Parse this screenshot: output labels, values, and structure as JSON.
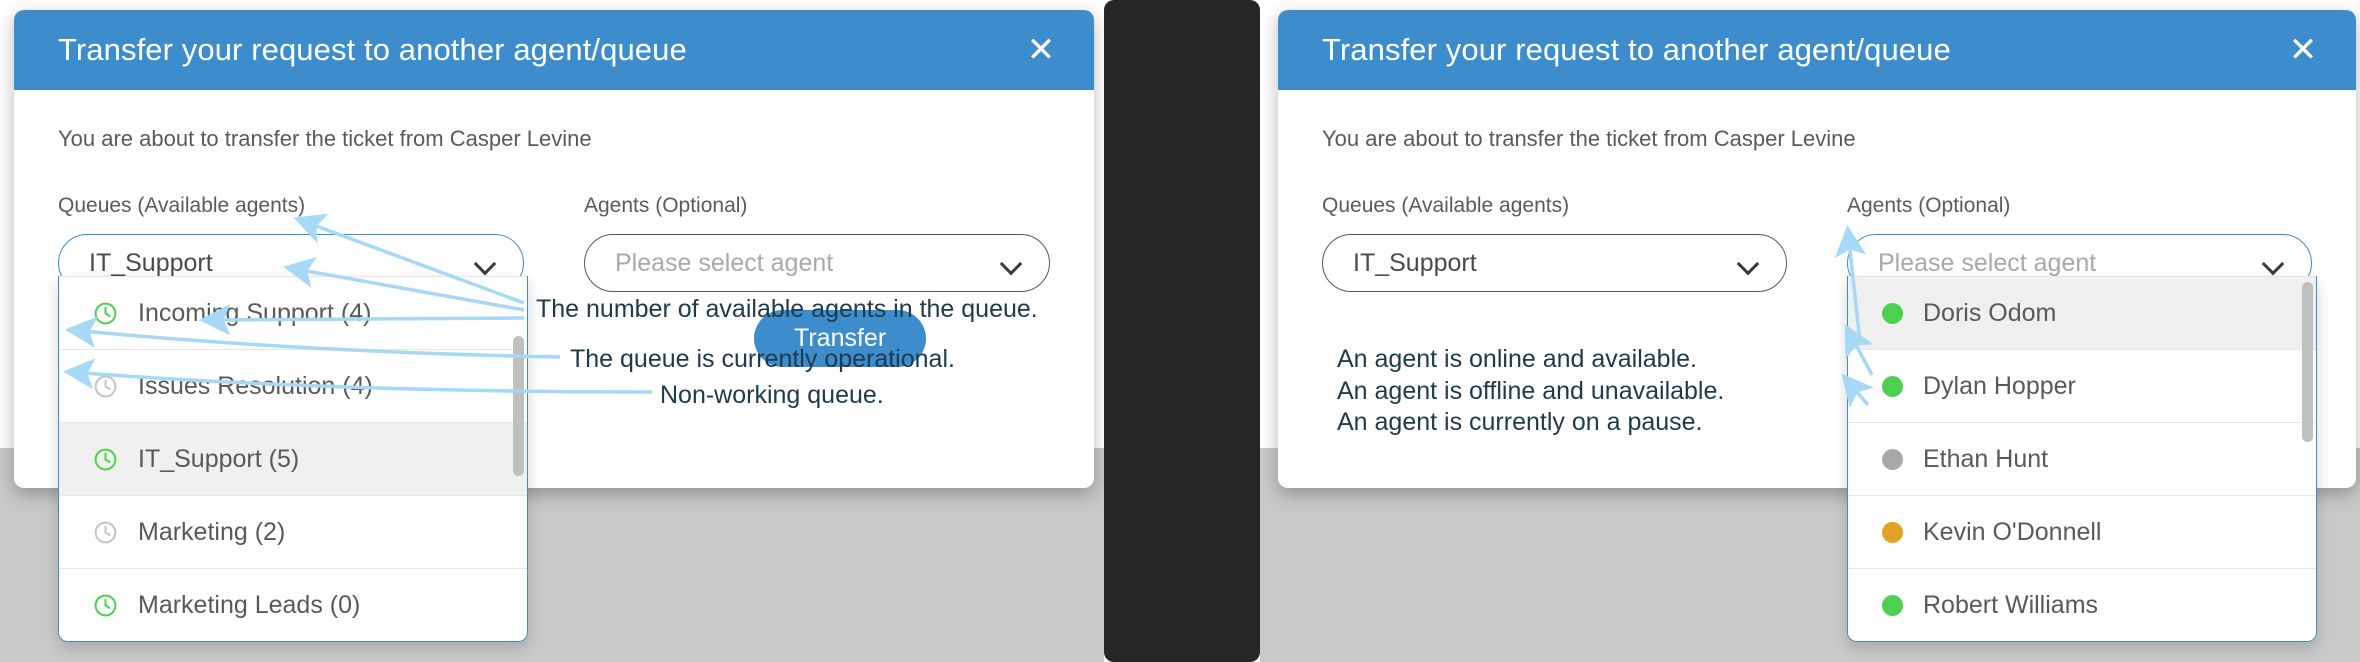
{
  "dialog": {
    "title": "Transfer your request to another agent/queue",
    "close_icon": "close-icon",
    "subtitle": "You are about to transfer the ticket from Casper Levine",
    "queues_label": "Queues (Available agents)",
    "agents_label": "Agents (Optional)",
    "queue_value": "IT_Support",
    "agent_placeholder": "Please select agent",
    "transfer_label": "Transfer"
  },
  "colors": {
    "header_blue": "#3d8dcc",
    "online_green": "#4ed04e",
    "offline_gray": "#a8a8a8",
    "pause_orange": "#e0a324",
    "annotation_text": "#1e3a4d",
    "arrow_blue": "#a7d8f5",
    "selected_row": "#f0f0f0",
    "gap_dark": "#262626"
  },
  "queues": [
    {
      "label": "Incoming Support (4)",
      "status": "operational",
      "icon": "clock-icon",
      "selected": false
    },
    {
      "label": "Issues Resolution (4)",
      "status": "non-working",
      "icon": "clock-icon",
      "selected": false
    },
    {
      "label": "IT_Support (5)",
      "status": "operational",
      "icon": "clock-icon",
      "selected": true
    },
    {
      "label": "Marketing (2)",
      "status": "non-working",
      "icon": "clock-icon",
      "selected": false
    },
    {
      "label": "Marketing Leads (0)",
      "status": "operational",
      "icon": "clock-icon",
      "selected": false
    }
  ],
  "agents": [
    {
      "label": "Doris Odom",
      "status": "online",
      "icon": "status-dot-icon",
      "selected": true
    },
    {
      "label": "Dylan Hopper",
      "status": "online",
      "icon": "status-dot-icon",
      "selected": false
    },
    {
      "label": "Ethan Hunt",
      "status": "offline",
      "icon": "status-dot-icon",
      "selected": false
    },
    {
      "label": "Kevin O'Donnell",
      "status": "pause",
      "icon": "status-dot-icon",
      "selected": false
    },
    {
      "label": "Robert Williams",
      "status": "online",
      "icon": "status-dot-icon",
      "selected": false
    }
  ],
  "annotations_left": [
    "The number of available agents in the queue.",
    "The queue is currently operational.",
    "Non-working queue."
  ],
  "annotations_right": [
    "An agent is online and available.",
    "An agent is offline and unavailable.",
    "An agent is currently on a pause."
  ]
}
